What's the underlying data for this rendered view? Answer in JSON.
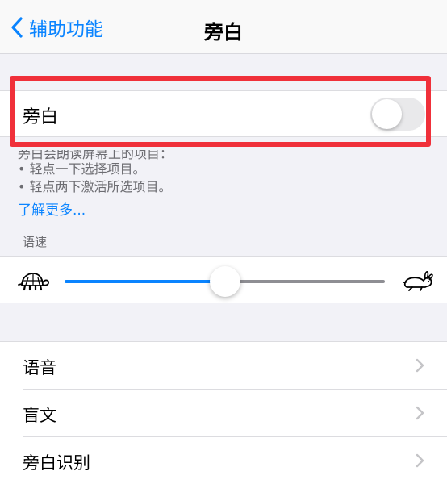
{
  "nav": {
    "back_label": "辅助功能",
    "title": "旁白"
  },
  "voiceover": {
    "label": "旁白",
    "enabled": false
  },
  "description": {
    "heading": "旁白会朗读屏幕上的项目：",
    "bullet1": "• 轻点一下选择项目。",
    "bullet2": "• 轻点两下激活所选项目。",
    "learn_more": "了解更多..."
  },
  "speech_rate": {
    "section_label": "语速",
    "value": 0.5
  },
  "menu": {
    "items": [
      {
        "label": "语音"
      },
      {
        "label": "盲文"
      },
      {
        "label": "旁白识别"
      }
    ]
  },
  "colors": {
    "accent": "#0a84ff",
    "highlight_border": "#f0303a",
    "background": "#f2f2f7"
  }
}
